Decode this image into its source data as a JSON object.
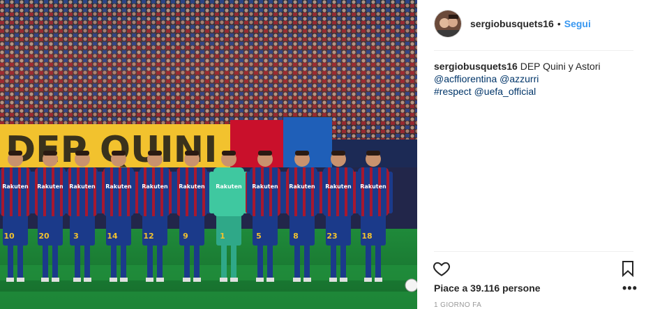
{
  "post": {
    "photo_alt": "Instagram post photo",
    "player_numbers": [
      "10",
      "20",
      "3",
      "14",
      "12",
      "9",
      "1",
      "5",
      "8",
      "23",
      "18"
    ],
    "banner_text": "DEP QUINI",
    "shirt_sponsor": "Rakuten"
  },
  "header": {
    "username": "sergiobusquets16",
    "separator": "•",
    "follow_label": "Segui"
  },
  "caption": {
    "username": "sergiobusquets16",
    "text": "DEP Quini y Astori",
    "mentions_line1": [
      "@acffiorentina",
      "@azzurri"
    ],
    "line3_hashtag": "#respect",
    "line3_mention": "@uefa_official"
  },
  "actions": {
    "like_icon": "heart-outline-icon",
    "save_icon": "bookmark-outline-icon",
    "more_label": "•••"
  },
  "likes": {
    "text": "Piace a 39.116 persone"
  },
  "timestamp": "1 GIORNO FA",
  "colors": {
    "follow": "#3897f0",
    "link": "#003569",
    "muted": "#999999",
    "blaugrana_blue": "#1b3a8a",
    "blaugrana_red": "#a7182f"
  }
}
